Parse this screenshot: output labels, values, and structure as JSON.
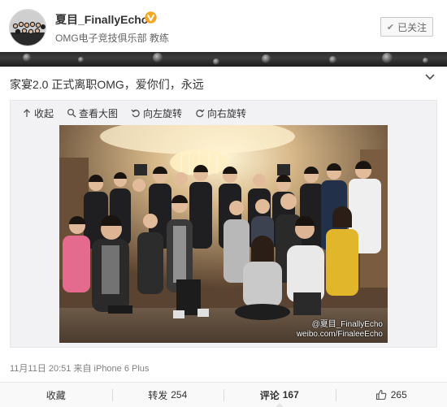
{
  "header": {
    "user_name": "夏目_FinallyEcho",
    "user_desc": "OMG电子竞技俱乐部 教练",
    "follow_label": "已关注",
    "verified_color": "#f5a623"
  },
  "post": {
    "text": "家宴2.0 正式离职OMG，爱你们，永远",
    "toolbar": {
      "collect": "收起",
      "view_large": "查看大图",
      "rotate_left": "向左旋转",
      "rotate_right": "向右旋转"
    },
    "watermark_line1": "@夏目_FinallyEcho",
    "watermark_line2": "weibo.com/FinaleeEcho",
    "timestamp": "11月11日 20:51 来自 iPhone 6 Plus"
  },
  "actions": {
    "favorite": "收藏",
    "repost_label": "转发",
    "repost_count": "254",
    "comment_label": "评论",
    "comment_count": "167",
    "like_count": "265"
  }
}
